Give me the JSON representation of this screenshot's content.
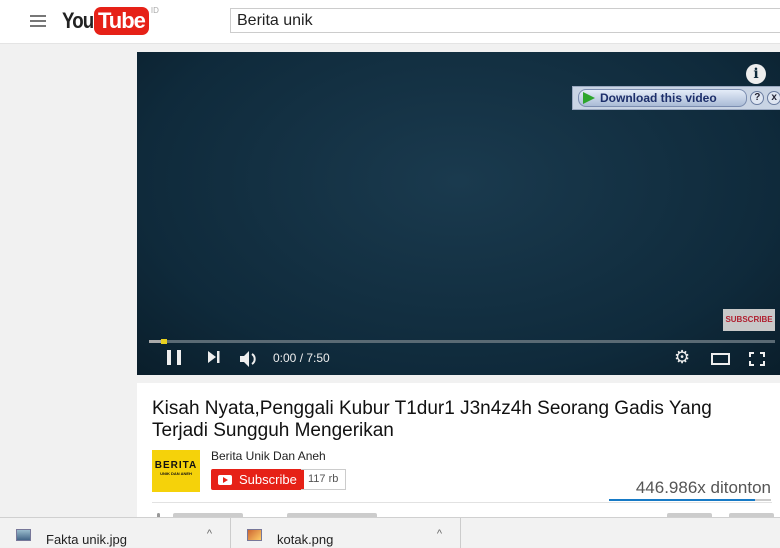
{
  "header": {
    "logo": {
      "you": "You",
      "tube": "Tube",
      "country": "ID"
    },
    "search_value": "Berita unik"
  },
  "player": {
    "info_icon": "i",
    "download_addon": {
      "label": "Download this video",
      "help": "?",
      "close": "x"
    },
    "subscribe_watermark": "SUBSCRIBE",
    "time": "0:00 / 7:50",
    "progress_played_fraction": 0.02,
    "accent": "#e8d020"
  },
  "video": {
    "title": "Kisah Nyata,Penggali Kubur T1dur1 J3n4z4h Seorang Gadis Yang Terjadi Sungguh Mengerikan",
    "channel": {
      "logo_main": "BERITA",
      "logo_sub": "UNIK DAN ANEH",
      "name": "Berita Unik Dan Aneh"
    },
    "subscribe_label": "Subscribe",
    "subscriber_count": "117 rb",
    "views": "446.986x ditonton",
    "like_fraction": 0.9,
    "brand_color": "#e62117"
  },
  "downloads": [
    {
      "name": "Fakta unik.jpg",
      "icon": "image-file-icon"
    },
    {
      "name": "kotak.png",
      "icon": "image-file-icon"
    }
  ]
}
